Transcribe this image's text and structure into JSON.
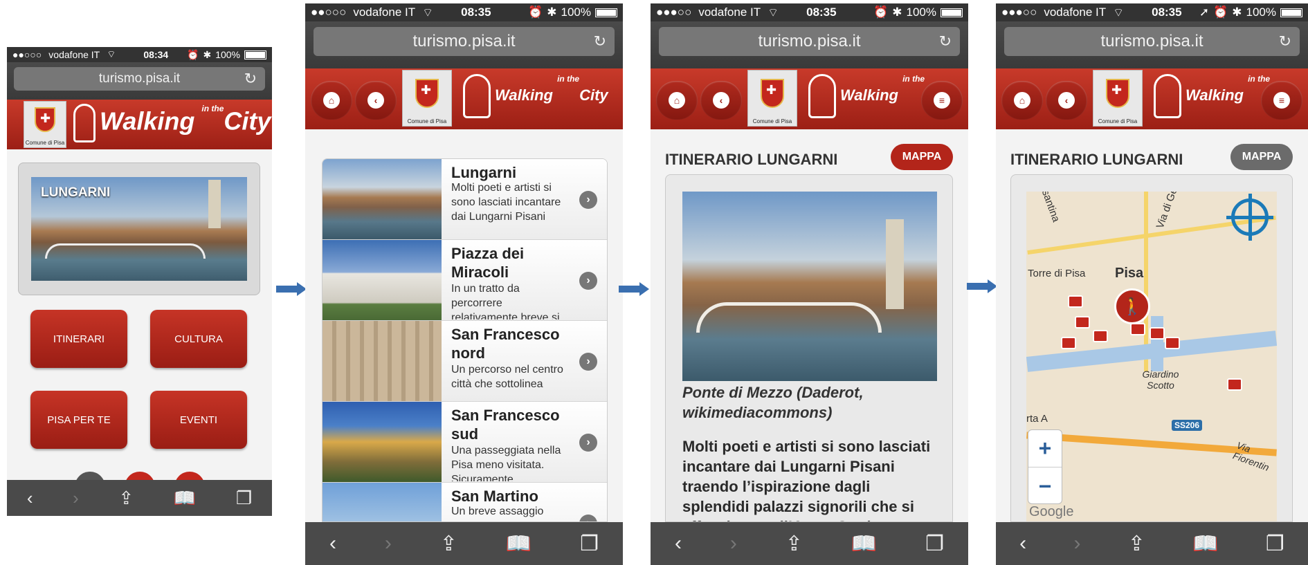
{
  "status": {
    "carrier": "vodafone IT",
    "signal_p1": "●●○○○",
    "signal_p2": "●●○○○",
    "signal_p3": "●●●○○",
    "signal_p4": "●●●○○",
    "battery": "100%",
    "time_p1": "08:34",
    "time_p2": "08:35",
    "time_p3": "08:35",
    "time_p4": "08:35",
    "wifi_icon": "wifi-icon",
    "alarm_icon": "alarm-icon",
    "bluetooth_icon": "bluetooth-icon",
    "location_icon": "location-icon"
  },
  "browser": {
    "url": "turismo.pisa.it",
    "reload_glyph": "↻",
    "back_glyph": "‹",
    "forward_glyph": "›",
    "share_glyph": "⇪",
    "bookmarks_glyph": "📖",
    "tabs_glyph": "❐"
  },
  "header": {
    "crest_label": "Comune di Pisa",
    "logo_walking": "Walking",
    "logo_in_the": "in the",
    "logo_city": "City",
    "home_glyph": "⌂",
    "back_glyph": "‹",
    "menu_glyph": "≡"
  },
  "home": {
    "hero_title": "LUNGARNI",
    "buttons": [
      "ITINERARI",
      "CULTURA",
      "PISA PER TE",
      "EVENTI"
    ]
  },
  "list": {
    "items": [
      {
        "title": "Lungarni",
        "desc": "Molti poeti e artisti si sono lasciati incantare dai Lungarni Pisani"
      },
      {
        "title": "Piazza dei Miracoli",
        "desc": "In un tratto da percorrere relativamente breve si"
      },
      {
        "title": "San Francesco nord",
        "desc": "Un percorso nel centro città che sottolinea"
      },
      {
        "title": "San Francesco sud",
        "desc": "Una passeggiata nella Pisa meno visitata. Sicuramente"
      },
      {
        "title": "San Martino",
        "desc": "Un breve assaggio"
      }
    ],
    "chevron_glyph": "›"
  },
  "detail": {
    "section_title": "ITINERARIO LUNGARNI",
    "map_button": "MAPPA",
    "caption": "Ponte di Mezzo (Daderot, wikimediacommons)",
    "body": "Molti poeti e artisti si sono lasciati incantare dai Lungarni Pisani traendo l’ispirazione dagli splendidi palazzi signorili che si affacciano sull’Arno. Oggi queste"
  },
  "map": {
    "labels": {
      "pisa": "Pisa",
      "torre": "Torre di Pisa",
      "giardino": "Giardino Scotto",
      "ss206": "SS206",
      "via_fiorentina": "Via Fiorentin",
      "via_del_gel": "Via di Gel.",
      "aurelia": "rasantina",
      "porta": "rta A",
      "google": "Google"
    },
    "zoom_in": "+",
    "zoom_out": "−",
    "walker_glyph": "🚶"
  },
  "colors": {
    "brand_red": "#b3251a",
    "arrow_blue": "#3a6fb0",
    "map_locate": "#1b7ab8"
  }
}
